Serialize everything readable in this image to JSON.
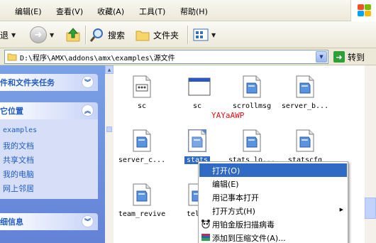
{
  "menubar": {
    "items": [
      "编辑(E)",
      "查看(V)",
      "收藏(A)",
      "工具(T)",
      "帮助(H)"
    ]
  },
  "toolbar": {
    "back_label": "退",
    "search_label": "搜索",
    "folders_label": "文件夹"
  },
  "address": {
    "path": "D:\\程序\\AMX\\addons\\amx\\examples\\源文件",
    "go_label": "转到"
  },
  "taskpane": {
    "file_tasks_title": "件和文件夹任务",
    "other_places_title": "它位置",
    "other_places": [
      "examples",
      "我的文档",
      "共享文档",
      "我的电脑",
      "网上邻居"
    ],
    "details_title": "细信息"
  },
  "files": [
    {
      "name": "sc",
      "icon": "dll-file-icon"
    },
    {
      "name": "sc",
      "icon": "window-file-icon"
    },
    {
      "name": "scrollmsg",
      "icon": "document-icon"
    },
    {
      "name": "server_b...",
      "icon": "document-icon"
    },
    {
      "name": "server_c...",
      "icon": "document-icon"
    },
    {
      "name": "stats",
      "icon": "document-icon",
      "selected": true
    },
    {
      "name": "stats_lo...",
      "icon": "document-icon"
    },
    {
      "name": "statscfg",
      "icon": "document-icon"
    },
    {
      "name": "team_revive",
      "icon": "document-icon"
    },
    {
      "name": "teler",
      "icon": "document-icon"
    }
  ],
  "watermark": "YAYaAWP",
  "context_menu": {
    "items": [
      {
        "label": "打开(O)",
        "highlighted": true
      },
      {
        "label": "编辑(E)"
      },
      {
        "label": "用记事本打开"
      },
      {
        "label": "打开方式(H)",
        "submenu": true
      },
      {
        "label": "用铂金版扫描病毒",
        "icon": "panda-icon"
      },
      {
        "label": "添加到压缩文件(A)...",
        "icon": "archive-icon"
      }
    ]
  },
  "colors": {
    "selection": "#316ac5",
    "task_pane": "#6f8fdc",
    "link": "#215dc6",
    "watermark": "#e2121a"
  }
}
